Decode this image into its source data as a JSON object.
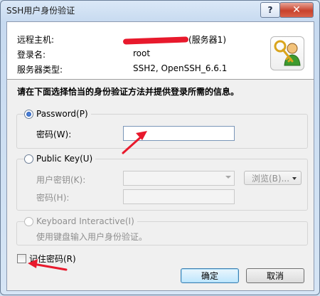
{
  "window": {
    "title": "SSH用户身份验证",
    "help_glyph": "?",
    "close_glyph": "✕"
  },
  "info": {
    "host_label": "远程主机:",
    "host_value": "(服务器1)",
    "user_label": "登录名:",
    "user_value": "root",
    "server_type_label": "服务器类型:",
    "server_type_value": "SSH2, OpenSSH_6.6.1"
  },
  "instruction": "请在下面选择恰当的身份验证方法并提供登录所需的信息。",
  "methods": {
    "password": {
      "label": "Password(P)",
      "field_label": "密码(W):",
      "selected": true
    },
    "public_key": {
      "label": "Public Key(U)",
      "user_key_label": "用户密钥(K):",
      "passphrase_label": "密码(H):",
      "browse_label": "浏览(B)...",
      "selected": false
    },
    "keyboard": {
      "label": "Keyboard Interactive(I)",
      "description": "使用键盘输入用户身份验证。",
      "selected": false
    }
  },
  "remember_label": "记住密码(R)",
  "buttons": {
    "ok": "确定",
    "cancel": "取消"
  },
  "colors": {
    "annotation": "#e8192c",
    "accent": "#3c7fb1"
  }
}
